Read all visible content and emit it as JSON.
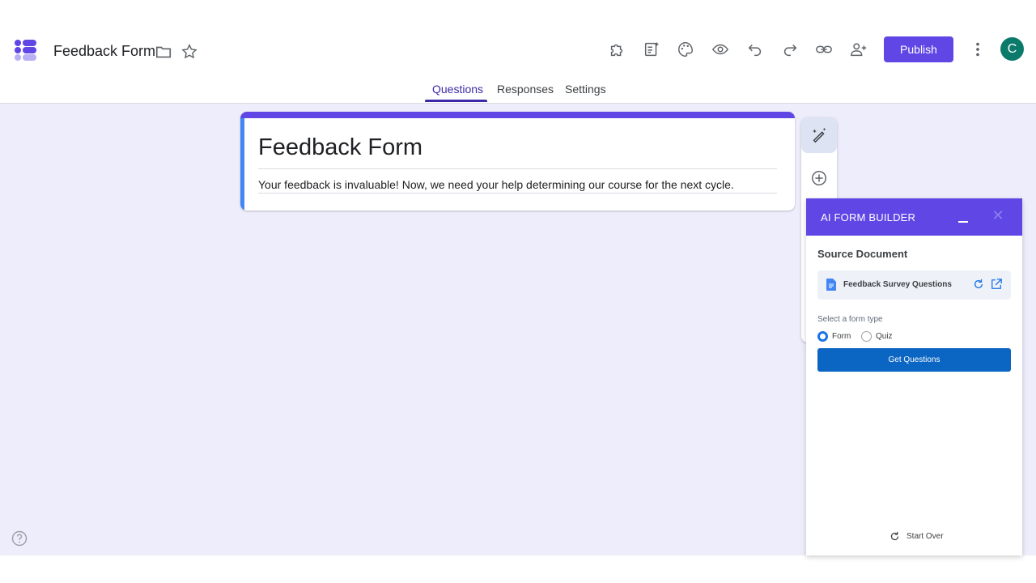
{
  "header": {
    "title": "Feedback Form",
    "publish_label": "Publish",
    "avatar_letter": "C",
    "accent_color": "#5f46e5"
  },
  "tabs": [
    {
      "label": "Questions",
      "active": true
    },
    {
      "label": "Responses",
      "active": false
    },
    {
      "label": "Settings",
      "active": false
    }
  ],
  "form": {
    "title": "Feedback Form",
    "description": "Your feedback is invaluable! Now, we need your help determining our course for the next cycle."
  },
  "ai_panel": {
    "title": "AI FORM BUILDER",
    "source_heading": "Source Document",
    "source_name": "Feedback Survey Questions",
    "type_label": "Select a form type",
    "options": [
      {
        "label": "Form",
        "selected": true
      },
      {
        "label": "Quiz",
        "selected": false
      }
    ],
    "get_button": "Get Questions",
    "start_over": "Start Over"
  }
}
